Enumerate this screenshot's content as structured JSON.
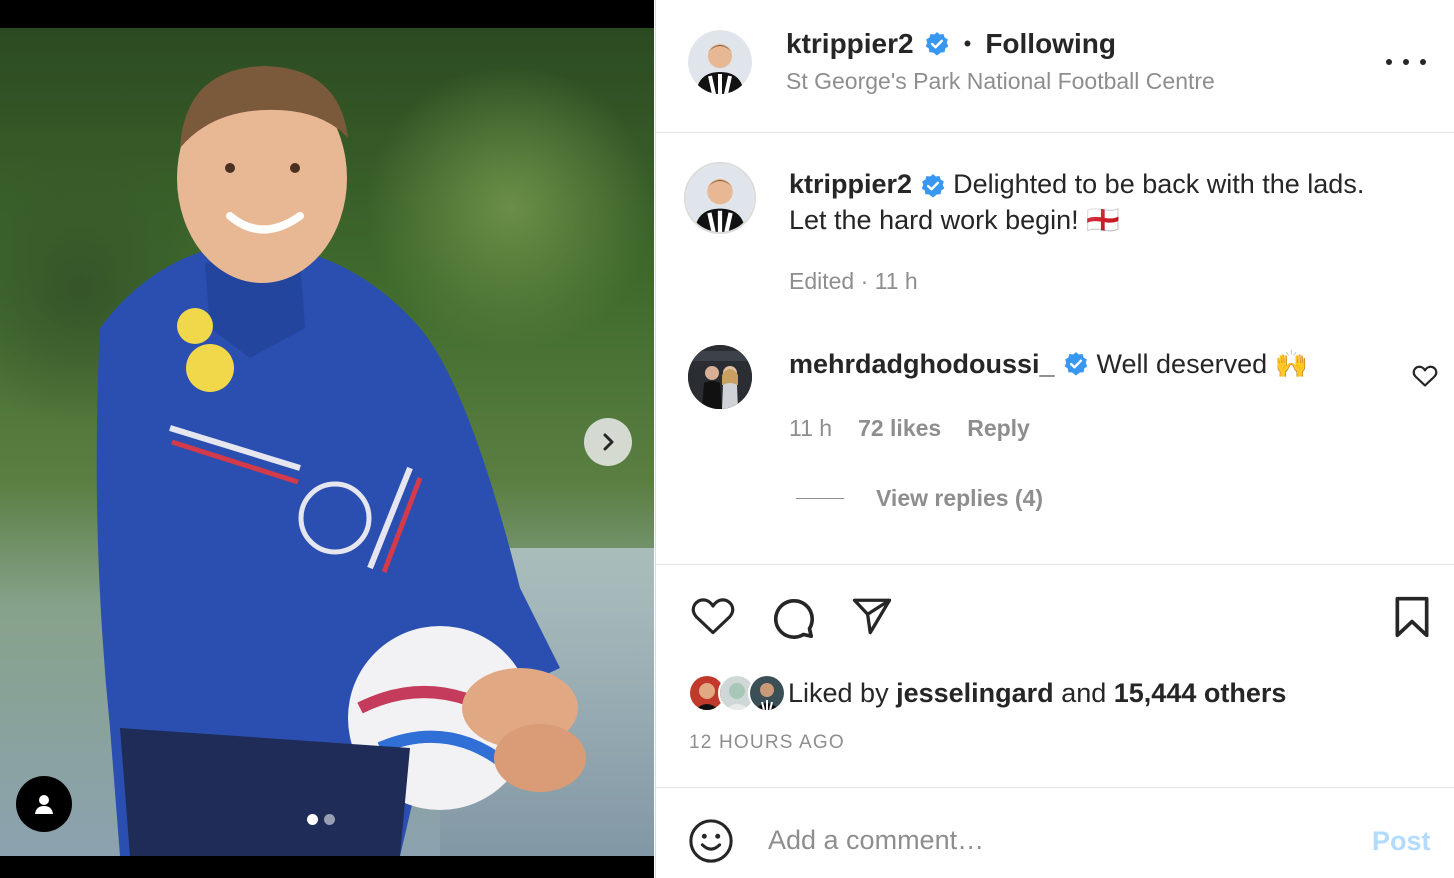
{
  "post": {
    "media": {
      "carousel_total": 2,
      "carousel_active": 1
    }
  },
  "header": {
    "username": "ktrippier2",
    "separator": "•",
    "follow_status": "Following",
    "location": "St George's Park National Football Centre"
  },
  "caption": {
    "username": "ktrippier2",
    "text": "Delighted to be back with the lads. Let the hard work begin! 🏴󠁧󠁢󠁥󠁮󠁧󠁿",
    "meta": "Edited · 11 h"
  },
  "comments": [
    {
      "username": "mehrdadghodoussi_",
      "text": "Well deserved 🙌",
      "time": "11 h",
      "likes": "72 likes",
      "reply_label": "Reply",
      "view_replies": "View replies (4)"
    }
  ],
  "likes": {
    "prefix": "Liked by",
    "liker": "jesselingard",
    "and": "and",
    "others": "15,444 others"
  },
  "timestamp": "12 HOURS AGO",
  "comment_box": {
    "placeholder": "Add a comment…",
    "post_label": "Post"
  },
  "colors": {
    "verified": "#3897f0",
    "post_disabled": "#b3dbff",
    "secondary_text": "#8e8e8e",
    "jersey_blue": "#2a4fb0"
  }
}
